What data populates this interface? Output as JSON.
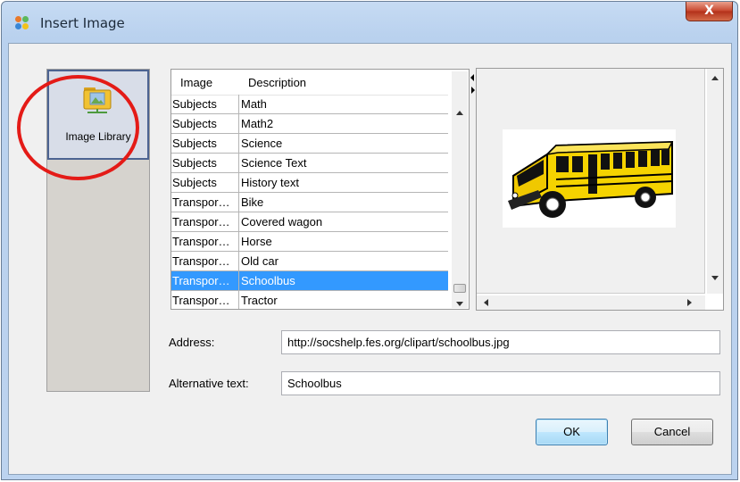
{
  "window": {
    "title": "Insert Image",
    "close_label": "X"
  },
  "library": {
    "label": "Image Library"
  },
  "table": {
    "columns": [
      "Image",
      "Description"
    ],
    "rows": [
      [
        "Subjects",
        "Math"
      ],
      [
        "Subjects",
        "Math2"
      ],
      [
        "Subjects",
        "Science"
      ],
      [
        "Subjects",
        "Science Text"
      ],
      [
        "Subjects",
        "History text"
      ],
      [
        "Transpor…",
        "Bike"
      ],
      [
        "Transpor…",
        "Covered wagon"
      ],
      [
        "Transpor…",
        "Horse"
      ],
      [
        "Transpor…",
        "Old car"
      ],
      [
        "Transpor…",
        "Schoolbus"
      ],
      [
        "Transpor…",
        "Tractor"
      ]
    ],
    "selected_index": 9
  },
  "form": {
    "address_label": "Address:",
    "address_value": "http://socshelp.fes.org/clipart/schoolbus.jpg",
    "alt_label": "Alternative text:",
    "alt_value": "Schoolbus"
  },
  "buttons": {
    "ok": "OK",
    "cancel": "Cancel"
  },
  "colors": {
    "selection": "#3399ff",
    "annotation_circle": "#e41b17",
    "bus_yellow": "#f5d300"
  }
}
